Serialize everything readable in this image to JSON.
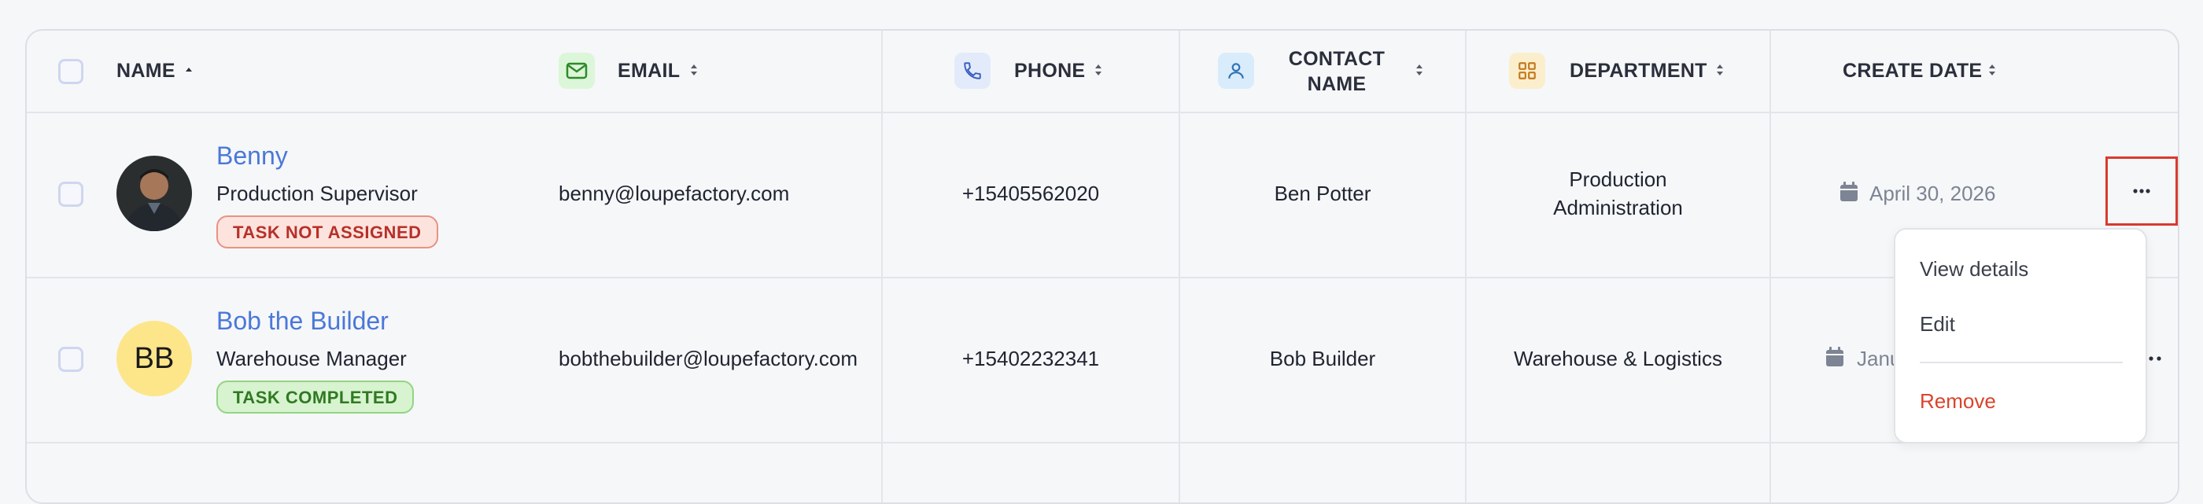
{
  "columns": {
    "name": "NAME",
    "email": "EMAIL",
    "phone": "PHONE",
    "contact_line1": "CONTACT",
    "contact_line2": "NAME",
    "department": "DEPARTMENT",
    "create_date": "CREATE DATE"
  },
  "icons": {
    "email": "mail-icon",
    "phone": "phone-icon",
    "contact": "user-icon",
    "department": "grid-icon",
    "date": "calendar-icon",
    "more": "more-horizontal-icon",
    "sort_asc": "sort-ascending-icon",
    "sort": "sort-icon"
  },
  "colors": {
    "link": "#4a78d8",
    "badge_not_assigned": "#b7302a",
    "badge_completed": "#2f7a22",
    "remove": "#d9442b",
    "highlight": "#d93a2f"
  },
  "rows": [
    {
      "name": "Benny",
      "role": "Production Supervisor",
      "status": "TASK NOT ASSIGNED",
      "email": "benny@loupefactory.com",
      "phone": "+15405562020",
      "contact": "Ben Potter",
      "department_line1": "Production",
      "department_line2": "Administration",
      "date": "April 30, 2026"
    },
    {
      "name": "Bob the Builder",
      "initials": "BB",
      "role": "Warehouse Manager",
      "status": "TASK COMPLETED",
      "email": "bobthebuilder@loupefactory.com",
      "phone": "+15402232341",
      "contact": "Bob Builder",
      "department": "Warehouse & Logistics",
      "date": "Janu"
    }
  ],
  "menu": {
    "view_details": "View details",
    "edit": "Edit",
    "remove": "Remove"
  }
}
